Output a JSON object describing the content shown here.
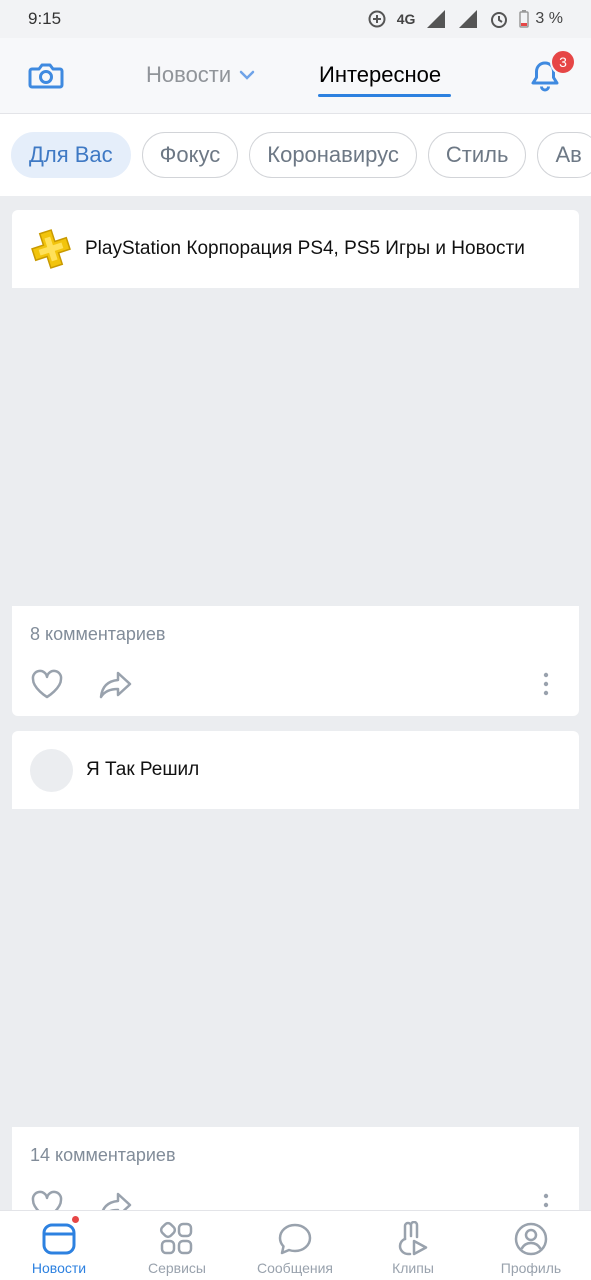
{
  "status_bar": {
    "time": "9:15",
    "network": "4G",
    "battery": "3 %"
  },
  "header": {
    "tab_news": "Новости",
    "tab_interesting": "Интересное",
    "notification_count": "3"
  },
  "chips": [
    "Для Вас",
    "Фокус",
    "Коронавирус",
    "Стиль",
    "Ав"
  ],
  "posts": [
    {
      "title": "PlayStation Корпорация PS4, PS5 Игры и Новости",
      "comments": "8 комментариев"
    },
    {
      "title": "Я Так Решил",
      "comments": "14 комментариев"
    }
  ],
  "bottom_nav": [
    {
      "label": "Новости",
      "icon": "news-icon"
    },
    {
      "label": "Сервисы",
      "icon": "services-icon"
    },
    {
      "label": "Сообщения",
      "icon": "messages-icon"
    },
    {
      "label": "Клипы",
      "icon": "clips-icon"
    },
    {
      "label": "Профиль",
      "icon": "profile-icon"
    }
  ],
  "colors": {
    "accent": "#2d81e0",
    "badge": "#e64646",
    "chip_active_bg": "#e5eefa"
  }
}
